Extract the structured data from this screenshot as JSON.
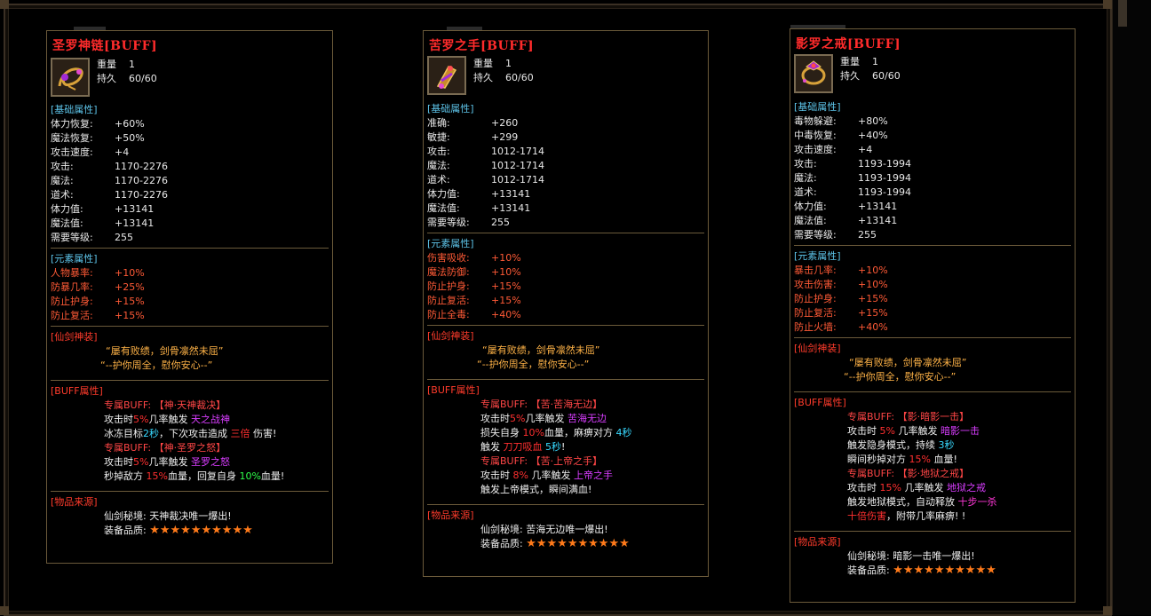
{
  "cards": [
    {
      "title": "圣罗神链[BUFF]",
      "meta": [
        {
          "k": "重量",
          "v": "1"
        },
        {
          "k": "持久",
          "v": "60/60"
        }
      ],
      "basic_header": "[基础属性]",
      "basic": [
        {
          "k": "体力恢复:",
          "v": "+60%"
        },
        {
          "k": "魔法恢复:",
          "v": "+50%"
        },
        {
          "k": "攻击速度:",
          "v": "+4"
        },
        {
          "k": "攻击:",
          "v": "1170-2276"
        },
        {
          "k": "魔法:",
          "v": "1170-2276"
        },
        {
          "k": "道术:",
          "v": "1170-2276"
        },
        {
          "k": "体力值:",
          "v": "+13141"
        },
        {
          "k": "魔法值:",
          "v": "+13141"
        },
        {
          "k": "需要等级:",
          "v": "255"
        }
      ],
      "element_header": "[元素属性]",
      "element": [
        {
          "k": "人物暴率:",
          "v": "+10%"
        },
        {
          "k": "防暴几率:",
          "v": "+25%"
        },
        {
          "k": "防止护身:",
          "v": "+15%"
        },
        {
          "k": "防止复活:",
          "v": "+15%"
        }
      ],
      "set_header": "[仙剑神装]",
      "quote1": "“屡有败绩，剑骨凛然未屈”",
      "quote2": "“--护你周全，慰你安心--”",
      "buff_header": "[BUFF属性]",
      "buff_lines": [
        [
          {
            "t": "专属BUFF: 【神·天神裁决】",
            "c": "pink"
          }
        ],
        [
          {
            "t": "攻击时",
            "c": "white"
          },
          {
            "t": "5%",
            "c": "red"
          },
          {
            "t": "几率触发 ",
            "c": "white"
          },
          {
            "t": "天之战神",
            "c": "purple"
          }
        ],
        [
          {
            "t": "冰冻目标",
            "c": "white"
          },
          {
            "t": "2秒",
            "c": "cyan"
          },
          {
            "t": "，下次攻击造成 ",
            "c": "white"
          },
          {
            "t": "三倍",
            "c": "red"
          },
          {
            "t": " 伤害!",
            "c": "white"
          }
        ],
        [
          {
            "t": "专属BUFF: 【神·圣罗之怒】",
            "c": "pink"
          }
        ],
        [
          {
            "t": "攻击时",
            "c": "white"
          },
          {
            "t": "5%",
            "c": "red"
          },
          {
            "t": "几率触发 ",
            "c": "white"
          },
          {
            "t": "圣罗之怒",
            "c": "purple"
          }
        ],
        [
          {
            "t": "秒掉敌方 ",
            "c": "white"
          },
          {
            "t": "15%",
            "c": "red"
          },
          {
            "t": "血量，回复自身 ",
            "c": "white"
          },
          {
            "t": "10%",
            "c": "green"
          },
          {
            "t": "血量!",
            "c": "white"
          }
        ]
      ],
      "source_header": "[物品来源]",
      "source_line": "仙剑秘境: 天神裁决唯一爆出!",
      "quality_label": "装备品质:",
      "quality_stars": "★★★★★★★★★★",
      "icon_name": "chain-necklace-icon",
      "colors": {
        "title": "#ff2b2b",
        "border": "#6b5a3a"
      }
    },
    {
      "title": "苦罗之手[BUFF]",
      "meta": [
        {
          "k": "重量",
          "v": "1"
        },
        {
          "k": "持久",
          "v": "60/60"
        }
      ],
      "basic_header": "[基础属性]",
      "basic": [
        {
          "k": "准确:",
          "v": "+260"
        },
        {
          "k": "敏捷:",
          "v": "+299"
        },
        {
          "k": "攻击:",
          "v": "1012-1714"
        },
        {
          "k": "魔法:",
          "v": "1012-1714"
        },
        {
          "k": "道术:",
          "v": "1012-1714"
        },
        {
          "k": "体力值:",
          "v": "+13141"
        },
        {
          "k": "魔法值:",
          "v": "+13141"
        },
        {
          "k": "需要等级:",
          "v": "255"
        }
      ],
      "element_header": "[元素属性]",
      "element": [
        {
          "k": "伤害吸收:",
          "v": "+10%"
        },
        {
          "k": "魔法防御:",
          "v": "+10%"
        },
        {
          "k": "防止护身:",
          "v": "+15%"
        },
        {
          "k": "防止复活:",
          "v": "+15%"
        },
        {
          "k": "防止全毒:",
          "v": "+40%"
        }
      ],
      "set_header": "[仙剑神装]",
      "quote1": "“屡有败绩，剑骨凛然未屈”",
      "quote2": "“--护你周全，慰你安心--”",
      "buff_header": "[BUFF属性]",
      "buff_lines": [
        [
          {
            "t": "专属BUFF: 【苦·苦海无边】",
            "c": "pink"
          }
        ],
        [
          {
            "t": "攻击时",
            "c": "white"
          },
          {
            "t": "5%",
            "c": "red"
          },
          {
            "t": "几率触发 ",
            "c": "white"
          },
          {
            "t": "苦海无边",
            "c": "purple"
          }
        ],
        [
          {
            "t": "损失自身 ",
            "c": "white"
          },
          {
            "t": "10%",
            "c": "red"
          },
          {
            "t": "血量，麻痹对方 ",
            "c": "white"
          },
          {
            "t": "4秒",
            "c": "cyan"
          }
        ],
        [
          {
            "t": "触发 ",
            "c": "white"
          },
          {
            "t": "刀刀吸血",
            "c": "red"
          },
          {
            "t": " ",
            "c": "white"
          },
          {
            "t": "5秒",
            "c": "cyan"
          },
          {
            "t": "!",
            "c": "white"
          }
        ],
        [
          {
            "t": "专属BUFF: 【苦·上帝之手】",
            "c": "pink"
          }
        ],
        [
          {
            "t": "攻击时 ",
            "c": "white"
          },
          {
            "t": "8%",
            "c": "red"
          },
          {
            "t": " 几率触发 ",
            "c": "white"
          },
          {
            "t": "上帝之手",
            "c": "purple"
          }
        ],
        [
          {
            "t": "触发上帝模式，瞬间满血!",
            "c": "white"
          }
        ]
      ],
      "source_header": "[物品来源]",
      "source_line": "仙剑秘境: 苦海无边唯一爆出!",
      "quality_label": "装备品质:",
      "quality_stars": "★★★★★★★★★★",
      "icon_name": "gauntlet-bracelet-icon",
      "colors": {
        "title": "#ff2b2b",
        "border": "#6b5a3a"
      }
    },
    {
      "title": "影罗之戒[BUFF]",
      "meta": [
        {
          "k": "重量",
          "v": "1"
        },
        {
          "k": "持久",
          "v": "60/60"
        }
      ],
      "basic_header": "[基础属性]",
      "basic": [
        {
          "k": "毒物躲避:",
          "v": "+80%"
        },
        {
          "k": "中毒恢复:",
          "v": "+40%"
        },
        {
          "k": "攻击速度:",
          "v": "+4"
        },
        {
          "k": "攻击:",
          "v": "1193-1994"
        },
        {
          "k": "魔法:",
          "v": "1193-1994"
        },
        {
          "k": "道术:",
          "v": "1193-1994"
        },
        {
          "k": "体力值:",
          "v": "+13141"
        },
        {
          "k": "魔法值:",
          "v": "+13141"
        },
        {
          "k": "需要等级:",
          "v": "255"
        }
      ],
      "element_header": "[元素属性]",
      "element": [
        {
          "k": "暴击几率:",
          "v": "+10%"
        },
        {
          "k": "攻击伤害:",
          "v": "+10%"
        },
        {
          "k": "防止护身:",
          "v": "+15%"
        },
        {
          "k": "防止复活:",
          "v": "+15%"
        },
        {
          "k": "防止火墙:",
          "v": "+40%"
        }
      ],
      "set_header": "[仙剑神装]",
      "quote1": "“屡有败绩，剑骨凛然未屈”",
      "quote2": "“--护你周全，慰你安心--”",
      "buff_header": "[BUFF属性]",
      "buff_lines": [
        [
          {
            "t": "专属BUFF: 【影·暗影一击】",
            "c": "pink"
          }
        ],
        [
          {
            "t": "攻击时 ",
            "c": "white"
          },
          {
            "t": "5%",
            "c": "red"
          },
          {
            "t": " 几率触发 ",
            "c": "white"
          },
          {
            "t": "暗影一击",
            "c": "purple"
          }
        ],
        [
          {
            "t": "触发隐身模式，持续 ",
            "c": "white"
          },
          {
            "t": "3秒",
            "c": "cyan"
          }
        ],
        [
          {
            "t": "瞬间秒掉对方 ",
            "c": "white"
          },
          {
            "t": "15%",
            "c": "red"
          },
          {
            "t": " 血量!",
            "c": "white"
          }
        ],
        [
          {
            "t": "专属BUFF: 【影·地狱之戒】",
            "c": "pink"
          }
        ],
        [
          {
            "t": "攻击时 ",
            "c": "white"
          },
          {
            "t": "15%",
            "c": "red"
          },
          {
            "t": " 几率触发 ",
            "c": "white"
          },
          {
            "t": "地狱之戒",
            "c": "purple"
          }
        ],
        [
          {
            "t": "触发地狱模式，自动释放 ",
            "c": "white"
          },
          {
            "t": "十步一杀",
            "c": "mag"
          }
        ],
        [
          {
            "t": "十倍伤害",
            "c": "red"
          },
          {
            "t": "，附带几率麻痹! !",
            "c": "white"
          }
        ]
      ],
      "source_header": "[物品来源]",
      "source_line": "仙剑秘境: 暗影一击唯一爆出!",
      "quality_label": "装备品质:",
      "quality_stars": "★★★★★★★★★★",
      "icon_name": "ring-icon",
      "colors": {
        "title": "#ff2b2b",
        "border": "#6b5a3a"
      }
    }
  ]
}
